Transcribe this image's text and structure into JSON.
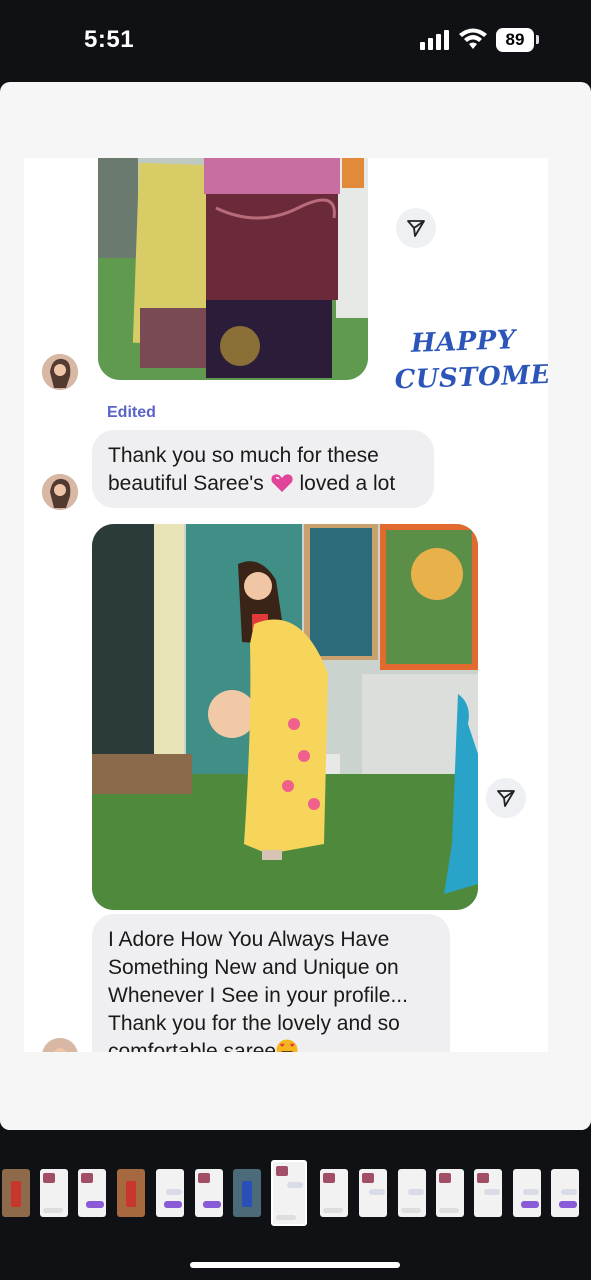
{
  "status_bar": {
    "time": "5:51",
    "battery": "89",
    "icons": [
      "signal-icon",
      "wifi-icon",
      "battery-icon"
    ]
  },
  "post": {
    "edited_label": "Edited",
    "overlay_text_line1": "HAPPY",
    "overlay_text_line2": "CUSTOMER",
    "message1_line1": "Thank you so much for these",
    "message1_line2a": "beautiful Saree's",
    "message1_line2b": "loved a lot",
    "message1_emoji": "pink-heart",
    "message2_lines": [
      "I Adore How You Always Have",
      "Something New and Unique on",
      "Whenever I See in your profile...",
      "Thank you for the lovely and so"
    ],
    "message2_last_line": "comfortable saree",
    "message2_emoji": "heart-eyes-emoji",
    "photo1_desc": "folded-sarees-photo",
    "photo2_desc": "woman-in-yellow-saree-photo"
  },
  "thumbnail_strip": {
    "count": 16,
    "active_index": 7
  },
  "colors": {
    "background": "#0f1114",
    "bubble": "#efeff1",
    "edited": "#5b63c8",
    "overlay_text": "#2b55b8"
  }
}
